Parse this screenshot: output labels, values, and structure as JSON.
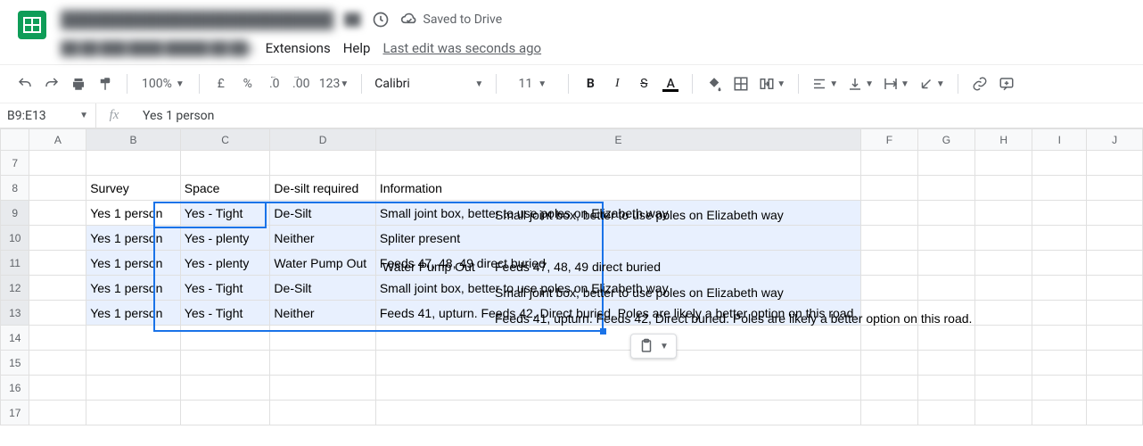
{
  "header": {
    "doc_title_blurred": "████████████████████████",
    "saved_label": "Saved to Drive",
    "menu_blurred": "██ ██ ███ ████ █████ ██ ██s",
    "menu_extensions": "Extensions",
    "menu_help": "Help",
    "last_edit": "Last edit was seconds ago"
  },
  "toolbar": {
    "zoom": "100%",
    "currency": "£",
    "percent": "%",
    "dec_dec": ".0",
    "inc_dec": ".00",
    "numfmt": "123",
    "font_name": "Calibri",
    "font_size": "11",
    "bold": "B",
    "italic": "I",
    "strike": "S",
    "textcolor": "A"
  },
  "namebox": {
    "ref": "B9:E13",
    "formula": "Yes 1 person"
  },
  "columns": [
    "A",
    "B",
    "C",
    "D",
    "E",
    "F",
    "G",
    "H",
    "I",
    "J"
  ],
  "rows_start": 7,
  "rows_end": 17,
  "selected_cols": [
    "B",
    "C",
    "D",
    "E"
  ],
  "selected_rows": [
    9,
    10,
    11,
    12,
    13
  ],
  "active_cell": "B9",
  "cells": {
    "B8": "Survey",
    "C8": "Space",
    "D8": "De-silt required",
    "E8": "Information",
    "B9": "Yes 1 person",
    "C9": "Yes - Tight",
    "D9": "De-Silt",
    "E9": "Small joint box, better to use poles on Elizabeth way",
    "B10": "Yes 1 person",
    "C10": "Yes - plenty",
    "D10": "Neither",
    "E10": "Spliter present",
    "B11": "Yes 1 person",
    "C11": "Yes - plenty",
    "D11": "Water Pump Out",
    "E11": "Feeds 47, 48, 49 direct buried",
    "B12": "Yes 1 person",
    "C12": "Yes - Tight",
    "D12": "De-Silt",
    "E12": "Small joint box, better to use poles on Elizabeth way",
    "B13": "Yes 1 person",
    "C13": "Yes - Tight",
    "D13": "Neither",
    "E13": "Feeds 41, upturn. Feeds 42, Direct buried. Poles are likely a better option on this road."
  },
  "chart_data": {
    "type": "table",
    "headers": [
      "Survey",
      "Space",
      "De-silt required",
      "Information"
    ],
    "rows": [
      [
        "Yes 1 person",
        "Yes - Tight",
        "De-Silt",
        "Small joint box, better to use poles on Elizabeth way"
      ],
      [
        "Yes 1 person",
        "Yes - plenty",
        "Neither",
        "Spliter present"
      ],
      [
        "Yes 1 person",
        "Yes - plenty",
        "Water Pump Out",
        "Feeds 47, 48, 49 direct buried"
      ],
      [
        "Yes 1 person",
        "Yes - Tight",
        "De-Silt",
        "Small joint box, better to use poles on Elizabeth way"
      ],
      [
        "Yes 1 person",
        "Yes - Tight",
        "Neither",
        "Feeds 41, upturn. Feeds 42, Direct buried. Poles are likely a better option on this road."
      ]
    ]
  }
}
